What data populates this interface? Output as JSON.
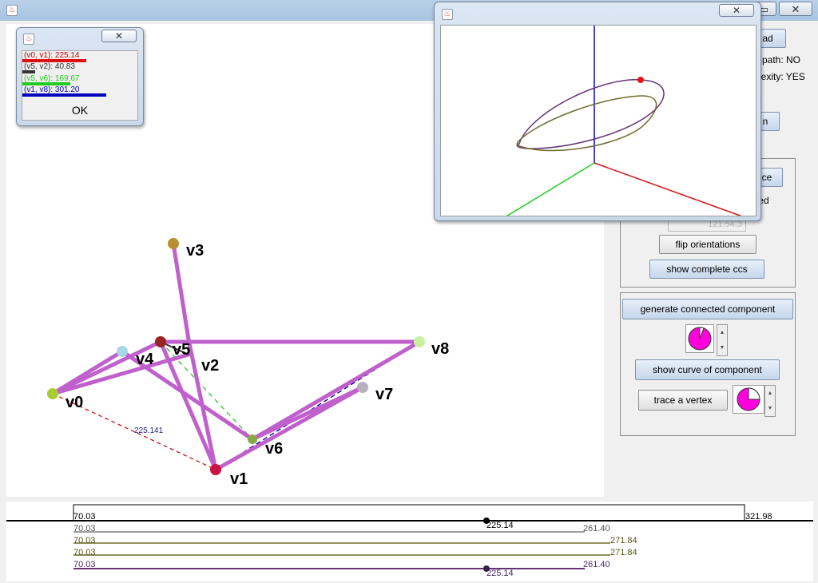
{
  "window": {
    "title": ""
  },
  "colors": {
    "edge": "#c060cc",
    "red": "#dd1111",
    "green": "#22cc22",
    "blue": "#0000bb"
  },
  "icons": {
    "app": "java-icon",
    "minimize": "minimize-icon",
    "maximize": "maximize-icon",
    "close": "close-icon"
  },
  "right_panel": {
    "load_label": "ad",
    "status_1": "-path: NO",
    "status_2": "lexity: YES",
    "button_partial_1": "n",
    "button_partial_2": "ce",
    "label_partial": "ted",
    "field_partial": "121.54.3",
    "flip_label": "flip orientations",
    "show_ccs_label": "show complete ccs",
    "generate_label": "generate connected component",
    "show_curve_label": "show curve of component",
    "trace_label": "trace a vertex"
  },
  "legend_dialog": {
    "title": "",
    "rows": [
      {
        "text": "(v0, v1):  225.14",
        "color": "#cc0000",
        "bar_fraction": 0.75
      },
      {
        "text": "(v5, v2):  40.83",
        "color": "#333333",
        "bar_fraction": 0.14
      },
      {
        "text": "(v5, v6):  169.67",
        "color": "#22cc22",
        "bar_fraction": 0.56
      },
      {
        "text": "(v1, v8):  301.20",
        "color": "#0000bb",
        "bar_fraction": 1.0
      }
    ],
    "ok_label": "OK"
  },
  "graph": {
    "vertices": [
      {
        "id": "v0",
        "label": "v0",
        "color": "#a8cc30"
      },
      {
        "id": "v1",
        "label": "v1",
        "color": "#cc1144"
      },
      {
        "id": "v2",
        "label": "v2",
        "color": "#c060cc"
      },
      {
        "id": "v3",
        "label": "v3",
        "color": "#b89030"
      },
      {
        "id": "v4",
        "label": "v4",
        "color": "#a8d8e8"
      },
      {
        "id": "v5",
        "label": "v5",
        "color": "#992222"
      },
      {
        "id": "v6",
        "label": "v6",
        "color": "#88aa44"
      },
      {
        "id": "v7",
        "label": "v7",
        "color": "#b8b0c0"
      },
      {
        "id": "v8",
        "label": "v8",
        "color": "#c8f0a0"
      }
    ],
    "edge_label": "225.141"
  },
  "bottom": {
    "rows": [
      {
        "left": "70.03",
        "right": "321.98",
        "mark": "225.14"
      },
      {
        "left": "70.03",
        "right": "261.40"
      },
      {
        "left": "70.03",
        "right": "271.84"
      },
      {
        "left": "70.03",
        "right": "271.84"
      },
      {
        "left": "70.03",
        "right": "261.40",
        "mark": "225.14"
      }
    ]
  }
}
